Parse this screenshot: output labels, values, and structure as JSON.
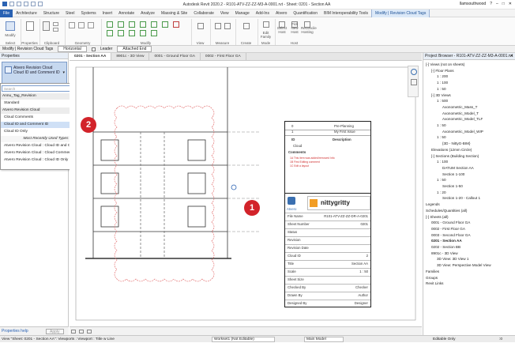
{
  "app": {
    "title": "Autodesk Revit 2020.2 - R101-ATV-ZZ-ZZ-M3-A-0001.rvt - Sheet: 0201 - Section AA",
    "user": "llamsouthwood",
    "help_label": "?"
  },
  "ribbon_tabs": [
    "File",
    "Architecture",
    "Structure",
    "Steel",
    "Systems",
    "Insert",
    "Annotate",
    "Analyze",
    "Massing & Site",
    "Collaborate",
    "View",
    "Manage",
    "Add-Ins",
    "Atvero",
    "Quantification",
    "BIM Interoperability Tools",
    "Modify | Revision Cloud Tags"
  ],
  "ribbon_groups": {
    "select": "Select",
    "properties": "Properties",
    "clipboard": "Clipboard",
    "geometry": "Geometry",
    "modify": "Modify",
    "view": "View",
    "measure": "Measure",
    "create": "Create",
    "mode": "Mode",
    "modify_btn": "Modify",
    "edit_family": "Edit Family",
    "select_host": "Select Host",
    "pick_new_host": "Pick New Host",
    "reconcile": "Reconcile Hosting",
    "host": "Host"
  },
  "options_bar": {
    "context": "Modify | Revision Cloud Tags",
    "orientation": "Horizontal",
    "leader_label": "Leader",
    "attached_end": "Attached End"
  },
  "properties": {
    "header": "Properties",
    "type_family": "Atvero Revision Cloud",
    "type_name": "Cloud ID and Comment ID",
    "search_placeholder": "Search",
    "help_link": "Properties help",
    "apply": "Apply",
    "dropdown": [
      {
        "label": "Annu_Tag_Revision",
        "kind": "fam"
      },
      {
        "label": "Standard",
        "kind": "item"
      },
      {
        "label": "Atvero Revision Cloud",
        "kind": "fam"
      },
      {
        "label": "Cloud Comments",
        "kind": "item"
      },
      {
        "label": "Cloud ID and Comment ID",
        "kind": "sel"
      },
      {
        "label": "Cloud ID Only",
        "kind": "item"
      },
      {
        "label": "Most Recently Used Types",
        "kind": "ctr"
      },
      {
        "label": "Atvero Revision Cloud : Cloud ID and Comment ID",
        "kind": "item"
      },
      {
        "label": "Atvero Revision Cloud : Cloud Comments",
        "kind": "item"
      },
      {
        "label": "Atvero Revision Cloud : Cloud ID Only",
        "kind": "item"
      }
    ]
  },
  "doc_tabs": [
    {
      "label": "0201 - Section AA",
      "active": true
    },
    {
      "label": "8901c - 3D View",
      "active": false
    },
    {
      "label": "0001 - Ground Floor GA",
      "active": false
    },
    {
      "label": "0002 - First Floor GA",
      "active": false
    }
  ],
  "badges": {
    "one": "1",
    "two": "2"
  },
  "title_block": {
    "rev_rows": [
      [
        "0",
        "Pre-Planning"
      ],
      [
        "1",
        "My First Issue"
      ]
    ],
    "id_header": "ID",
    "desc_header": "Description",
    "cloud_label": "Cloud",
    "comments_header": "Comments",
    "comment_lines": [
      "1A  This item was added/removed Info",
      "1B  First Editing comment",
      "1C  Edit a layout"
    ],
    "brand": "Atvero",
    "brand_name": "nittygritty",
    "fields": [
      [
        "File Name",
        "R101-ATV-ZZ-ZZ-DR-A-0201"
      ],
      [
        "Sheet Number",
        "0201"
      ],
      [
        "Status",
        ""
      ],
      [
        "Revision",
        ""
      ],
      [
        "Revision Date",
        ""
      ],
      [
        "Cloud ID",
        "2"
      ],
      [
        "Title",
        "Section AA"
      ],
      [
        "Scale",
        "1 : 50"
      ],
      [
        "Sheet Size",
        ""
      ],
      [
        "Checked By",
        "Checker"
      ],
      [
        "Drawn By",
        "Author"
      ],
      [
        "Designed By",
        "Designer"
      ]
    ]
  },
  "browser": {
    "header": "Project Browser - R101-ATV-ZZ-ZZ-M3-A-0001.rvt",
    "rows": [
      {
        "t": "[-] Views (not on sheets)",
        "i": 0
      },
      {
        "t": "[-] Floor Plans",
        "i": 1
      },
      {
        "t": "1 : 200",
        "i": 2
      },
      {
        "t": "1 : 100",
        "i": 2
      },
      {
        "t": "1 : 50",
        "i": 2
      },
      {
        "t": "[-] 3D Views",
        "i": 1
      },
      {
        "t": "1 : 500",
        "i": 2
      },
      {
        "t": "Axonometric_Mass_T",
        "i": 3
      },
      {
        "t": "Axonometric_Model_T",
        "i": 3
      },
      {
        "t": "Axonometric_Model_TLF",
        "i": 3
      },
      {
        "t": "1 : 50",
        "i": 2
      },
      {
        "t": "Axonometric_Model_WIP",
        "i": 3
      },
      {
        "t": "1 : 50",
        "i": 2
      },
      {
        "t": "{3D - NittyG-BIM}",
        "i": 3
      },
      {
        "t": "Elevations (12mm Circle)",
        "i": 1
      },
      {
        "t": "[-] Sections (Building Section)",
        "i": 1
      },
      {
        "t": "1 : 100",
        "i": 2
      },
      {
        "t": "DATUM Section AA",
        "i": 3
      },
      {
        "t": "Section 1-100",
        "i": 3
      },
      {
        "t": "1 : 50",
        "i": 2
      },
      {
        "t": "Section 1-50",
        "i": 3
      },
      {
        "t": "1 : 20",
        "i": 2
      },
      {
        "t": "Section 1-20 - Callout 1",
        "i": 3
      },
      {
        "t": "Legends",
        "i": 0
      },
      {
        "t": "Schedules/Quantities (all)",
        "i": 0
      },
      {
        "t": "[-] Sheets (all)",
        "i": 0
      },
      {
        "t": "0001 - Ground Floor GA",
        "i": 1
      },
      {
        "t": "0002 - First Floor GA",
        "i": 1
      },
      {
        "t": "0003 - Second Floor GA",
        "i": 1
      },
      {
        "t": "0201 - Section AA",
        "i": 1,
        "b": true
      },
      {
        "t": "0202 - Section BB",
        "i": 1
      },
      {
        "t": "8901c - 3D View",
        "i": 1
      },
      {
        "t": "3D View: 3D View 1",
        "i": 2
      },
      {
        "t": "3D View: Perspective Model View",
        "i": 2
      },
      {
        "t": "Families",
        "i": 0
      },
      {
        "t": "Groups",
        "i": 0
      },
      {
        "t": "Revit Links",
        "i": 0
      }
    ]
  },
  "status": {
    "hint": "View \"Sheet: 0201 - Section AA\": Viewports : Viewport : Title w Line",
    "workset": "Workset1 (Not Editable)",
    "main_model": "Main Model",
    "editable_only": "Editable Only",
    "zoom": ":0"
  },
  "view_bar": {
    "scale": "1 : 1"
  }
}
